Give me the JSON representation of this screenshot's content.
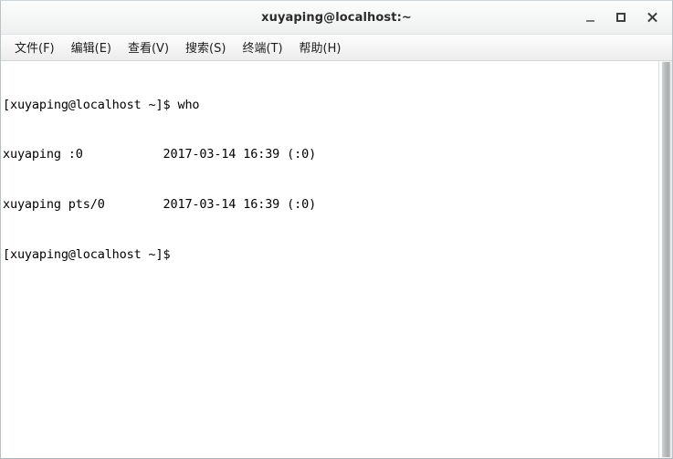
{
  "window": {
    "title": "xuyaping@localhost:~",
    "controls": {
      "minimize_label": "_",
      "maximize_label": "□",
      "close_label": "×"
    }
  },
  "menubar": {
    "items": [
      {
        "label": "文件(F)"
      },
      {
        "label": "编辑(E)"
      },
      {
        "label": "查看(V)"
      },
      {
        "label": "搜索(S)"
      },
      {
        "label": "终端(T)"
      },
      {
        "label": "帮助(H)"
      }
    ]
  },
  "terminal": {
    "lines": [
      "[xuyaping@localhost ~]$ who",
      "xuyaping :0           2017-03-14 16:39 (:0)",
      "xuyaping pts/0        2017-03-14 16:39 (:0)",
      "[xuyaping@localhost ~]$ "
    ],
    "prompt": "[xuyaping@localhost ~]$",
    "command": "who",
    "who_output": [
      {
        "user": "xuyaping",
        "line": ":0",
        "date": "2017-03-14",
        "time": "16:39",
        "from": "(:0)"
      },
      {
        "user": "xuyaping",
        "line": "pts/0",
        "date": "2017-03-14",
        "time": "16:39",
        "from": "(:0)"
      }
    ],
    "foreground_color": "#000000",
    "background_color": "#ffffff"
  }
}
